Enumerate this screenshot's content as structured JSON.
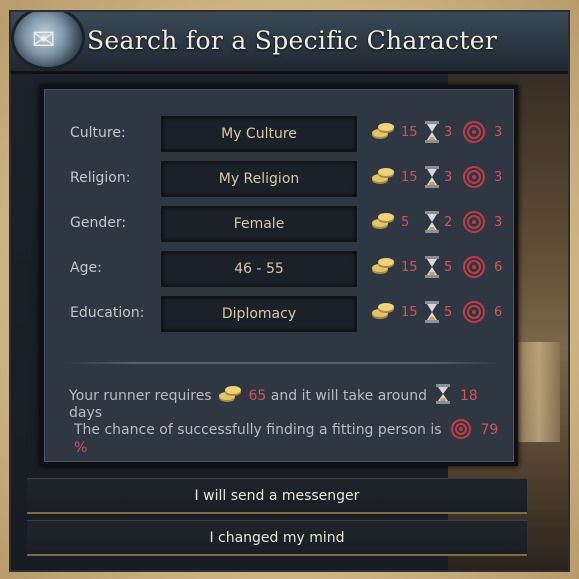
{
  "window": {
    "title": "Search for a Specific Character"
  },
  "criteria": [
    {
      "label": "Culture:",
      "value": "My Culture",
      "gold": "15",
      "time": "3",
      "chance": "3"
    },
    {
      "label": "Religion:",
      "value": "My Religion",
      "gold": "15",
      "time": "3",
      "chance": "3"
    },
    {
      "label": "Gender:",
      "value": "Female",
      "gold": "5",
      "time": "2",
      "chance": "3"
    },
    {
      "label": "Age:",
      "value": "46 - 55",
      "gold": "15",
      "time": "5",
      "chance": "6"
    },
    {
      "label": "Education:",
      "value": "Diplomacy",
      "gold": "15",
      "time": "5",
      "chance": "6"
    }
  ],
  "summary": {
    "runner_prefix": "Your runner requires",
    "runner_gold": "65",
    "runner_mid": "and it will take around",
    "runner_days": "18",
    "runner_suffix": "days",
    "chance_prefix": "The chance of successfully finding a fitting person is",
    "chance_value": "79 %"
  },
  "buttons": {
    "send": "I will send a messenger",
    "cancel": "I changed my mind"
  },
  "colors": {
    "cost_red": "#d6525a",
    "value_gold": "#d9c8a6",
    "button_border": "#7d6a47"
  },
  "icons": {
    "gold": "gold-coins-icon",
    "time": "hourglass-icon",
    "chance": "target-icon",
    "emblem": "scroll-emblem-icon"
  }
}
